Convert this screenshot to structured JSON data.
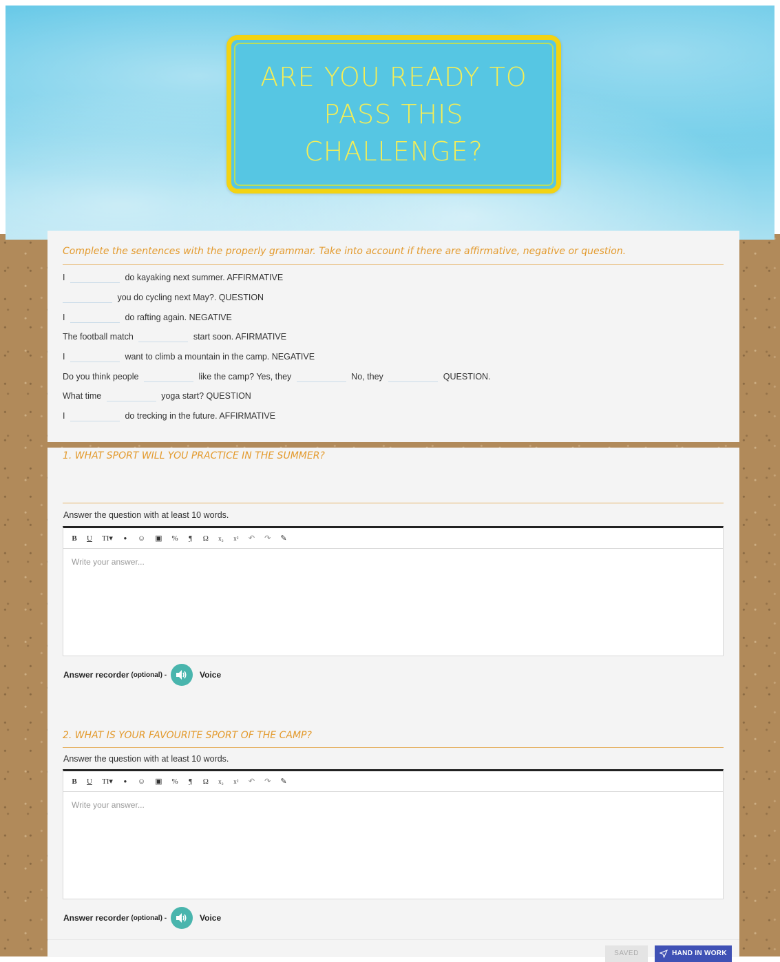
{
  "header": {
    "title": "Are you ready to pass this challenge?"
  },
  "exercise": {
    "instruction": "Complete the sentences with the properly grammar. Take into account if there are  affirmative, negative or question.",
    "sentences": [
      {
        "parts": [
          "I",
          "do kayaking next summer. AFFIRMATIVE"
        ]
      },
      {
        "parts": [
          "",
          "you do cycling next May?. QUESTION"
        ]
      },
      {
        "parts": [
          "I",
          "do rafting again. NEGATIVE"
        ]
      },
      {
        "parts": [
          "The football match",
          "start soon. AFIRMATIVE"
        ]
      },
      {
        "parts": [
          "I",
          "want to climb a mountain in the camp. NEGATIVE"
        ]
      },
      {
        "parts": [
          "Do you think people",
          "like the camp? Yes, they",
          "No, they",
          "QUESTION."
        ]
      },
      {
        "parts": [
          "What time",
          "yoga start? QUESTION"
        ]
      },
      {
        "parts": [
          "I",
          "do trecking in the future. AFFIRMATIVE"
        ]
      }
    ]
  },
  "question1": {
    "title": "1. What sport will you practice in the summer?",
    "hint": "Answer the question with at least 10 words.",
    "placeholder": "Write your answer...",
    "recorder_label": "Answer recorder",
    "recorder_optional": "(optional) -",
    "voice_label": "Voice"
  },
  "question2": {
    "title": "2. What is your favourite sport of the camp?",
    "hint": "Answer the question with at least 10 words.",
    "placeholder": "Write your answer...",
    "recorder_label": "Answer recorder",
    "recorder_optional": "(optional) -",
    "voice_label": "Voice"
  },
  "toolbar": {
    "items": [
      {
        "label": "B",
        "icon": "bold-icon"
      },
      {
        "label": "U",
        "icon": "underline-icon"
      },
      {
        "label": "TI▾",
        "icon": "text-size-icon"
      },
      {
        "label": "●",
        "icon": "color-drop-icon"
      },
      {
        "label": "☺",
        "icon": "emoji-icon"
      },
      {
        "label": "▣",
        "icon": "image-icon"
      },
      {
        "label": "%",
        "icon": "link-icon"
      },
      {
        "label": "¶",
        "icon": "paragraph-icon"
      },
      {
        "label": "Ω",
        "icon": "special-char-icon"
      },
      {
        "label": "x₂",
        "icon": "subscript-icon"
      },
      {
        "label": "x²",
        "icon": "superscript-icon"
      },
      {
        "label": "↶",
        "icon": "undo-icon"
      },
      {
        "label": "↷",
        "icon": "redo-icon"
      },
      {
        "label": "✎",
        "icon": "eraser-icon"
      }
    ]
  },
  "footer": {
    "saved_label": "SAVED",
    "hand_in_label": "HAND IN WORK"
  },
  "colors": {
    "accent_orange": "#e39a2d",
    "title_yellow": "#f2d313",
    "button_blue": "#3f51b5",
    "voice_teal": "#49b5ad"
  }
}
